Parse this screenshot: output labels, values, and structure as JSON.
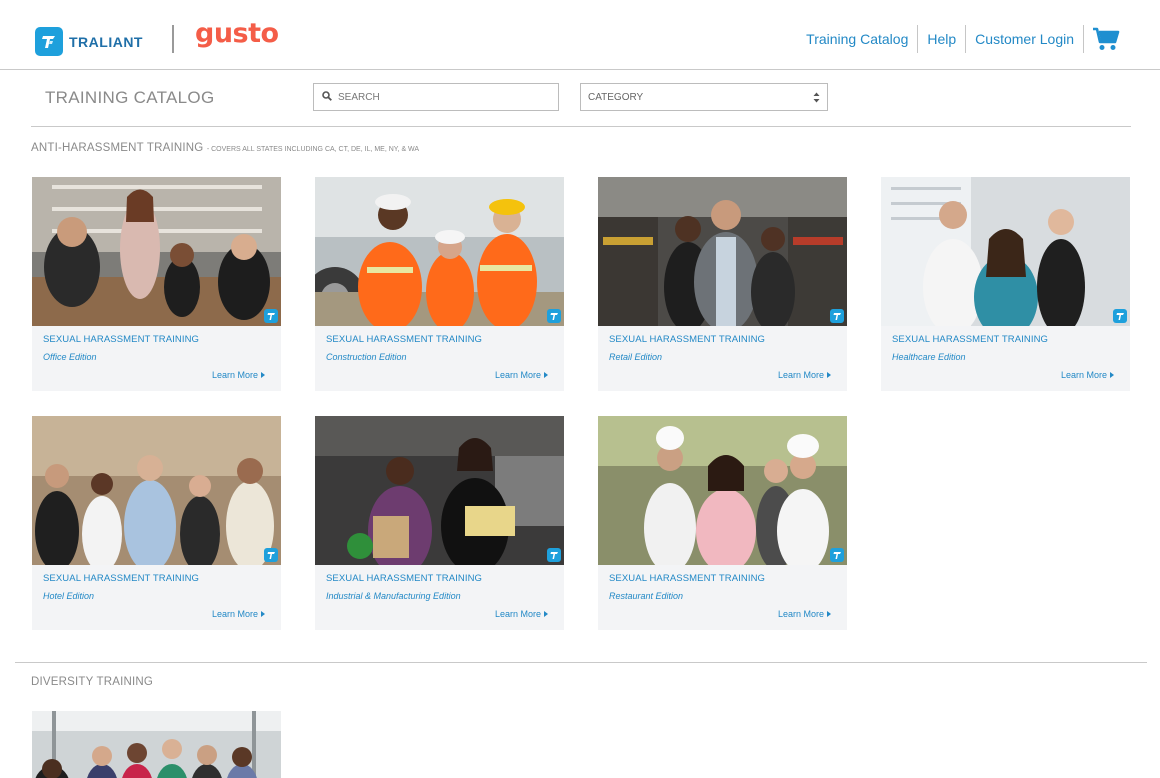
{
  "header": {
    "traliant_logo_text": "TRALIANT",
    "gusto_logo_text": "gusto",
    "nav": [
      {
        "label": "Training Catalog"
      },
      {
        "label": "Help"
      },
      {
        "label": "Customer Login"
      }
    ],
    "cart_icon": "shopping-cart-icon"
  },
  "toolbar": {
    "title": "TRAINING CATALOG",
    "search_placeholder": "SEARCH",
    "category_label": "CATEGORY"
  },
  "sections": [
    {
      "title": "ANTI-HARASSMENT TRAINING",
      "note": "- COVERS ALL STATES INCLUDING CA, CT, DE, IL, ME, NY, & WA",
      "cards": [
        {
          "title": "SEXUAL HARASSMENT TRAINING",
          "edition": "Office Edition",
          "cta": "Learn More"
        },
        {
          "title": "SEXUAL HARASSMENT TRAINING",
          "edition": "Construction Edition",
          "cta": "Learn More"
        },
        {
          "title": "SEXUAL HARASSMENT TRAINING",
          "edition": "Retail Edition",
          "cta": "Learn More"
        },
        {
          "title": "SEXUAL HARASSMENT TRAINING",
          "edition": "Healthcare Edition",
          "cta": "Learn More"
        },
        {
          "title": "SEXUAL HARASSMENT TRAINING",
          "edition": "Hotel Edition",
          "cta": "Learn More"
        },
        {
          "title": "SEXUAL HARASSMENT TRAINING",
          "edition": "Industrial & Manufacturing Edition",
          "cta": "Learn More"
        },
        {
          "title": "SEXUAL HARASSMENT TRAINING",
          "edition": "Restaurant Edition",
          "cta": "Learn More"
        }
      ]
    },
    {
      "title": "DIVERSITY TRAINING",
      "note": ""
    }
  ],
  "colors": {
    "link": "#2389c6",
    "brand_blue": "#1ea0dc",
    "gusto_red": "#f45d48",
    "card_bg": "#f3f4f6"
  }
}
